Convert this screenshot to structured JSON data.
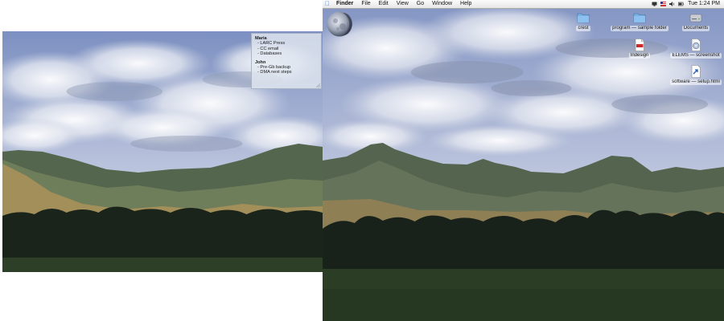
{
  "menubar": {
    "app": "Finder",
    "menus": [
      "File",
      "Edit",
      "View",
      "Go",
      "Window",
      "Help"
    ],
    "clock": "Tue 1:24 PM"
  },
  "desktop_icons": [
    {
      "label": "crest",
      "icon": "folder-icon"
    },
    {
      "label": "program — sample folder",
      "icon": "folder-icon"
    },
    {
      "label": "Documents",
      "icon": "hard-drive-icon"
    },
    {
      "label": "Indesign",
      "icon": "pdf-document-icon"
    },
    {
      "label": "ELEMS — screenshot",
      "icon": "disk-image-icon"
    },
    {
      "label": "software — setup.html",
      "icon": "alias-document-icon"
    }
  ],
  "sticky_note": {
    "sections": [
      {
        "name": "Maria",
        "items": [
          "- LARC Press",
          "- CC email",
          "- Databases"
        ]
      },
      {
        "name": "John",
        "items": [
          "- Pre-Gb backup",
          "- DMA next steps"
        ]
      }
    ]
  },
  "colors": {
    "menubar_bg": "#ececec",
    "sky_top": "#7f93c4",
    "sky_bottom": "#c9d0e4",
    "mountain": "#5c6b58",
    "trees": "#18221a",
    "meadow": "#2f4129",
    "folder_blue": "#7ab0e3"
  }
}
